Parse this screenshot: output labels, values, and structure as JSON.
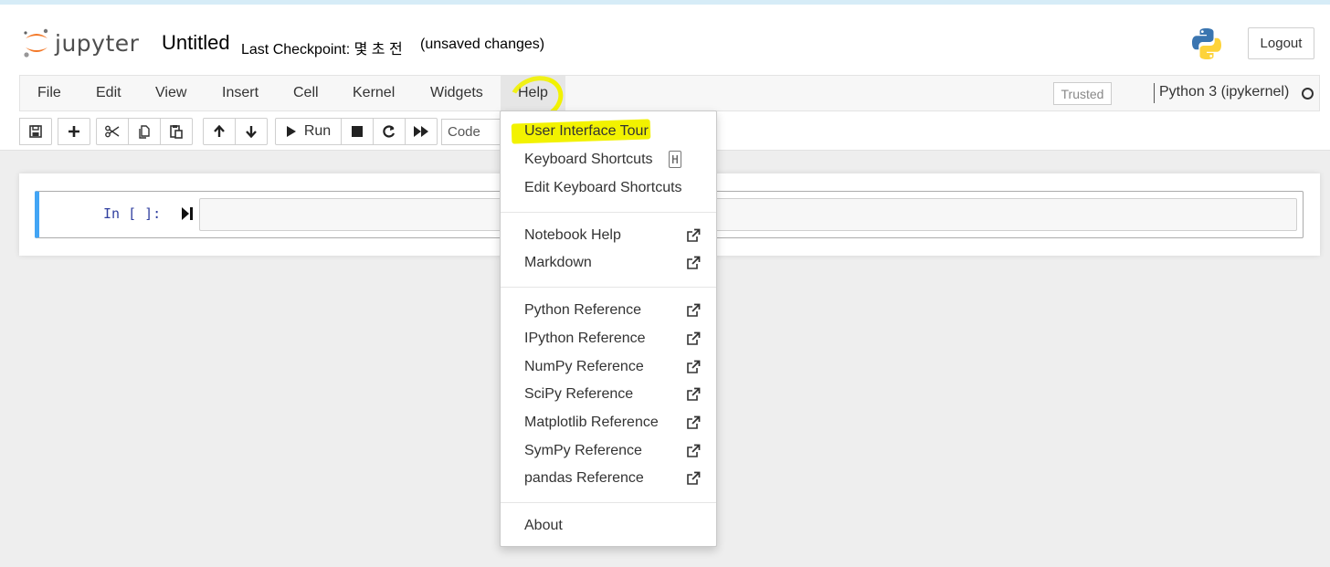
{
  "header": {
    "logo_text": "jupyter",
    "notebook_title": "Untitled",
    "checkpoint": "Last Checkpoint: 몇 초 전",
    "unsaved": "(unsaved changes)",
    "logout_label": "Logout"
  },
  "menubar": {
    "items": [
      "File",
      "Edit",
      "View",
      "Insert",
      "Cell",
      "Kernel",
      "Widgets",
      "Help"
    ],
    "trusted_label": "Trusted",
    "kernel_name": "Python 3 (ipykernel)"
  },
  "toolbar": {
    "run_label": "Run",
    "cell_type": "Code"
  },
  "cell": {
    "prompt": "In [ ]:"
  },
  "help_menu": {
    "items": [
      "User Interface Tour",
      "Keyboard Shortcuts",
      "Edit Keyboard Shortcuts",
      "Notebook Help",
      "Markdown",
      "Python Reference",
      "IPython Reference",
      "NumPy Reference",
      "SciPy Reference",
      "Matplotlib Reference",
      "SymPy Reference",
      "pandas Reference",
      "About"
    ],
    "shortcut_key": "H"
  },
  "colors": {
    "highlight": "#f2f200",
    "cell_accent": "#42a5f5",
    "prompt": "#303f9f",
    "logo_orange": "#f37726"
  },
  "icons": [
    "save-icon",
    "plus-icon",
    "cut-icon",
    "copy-icon",
    "paste-icon",
    "arrow-up-icon",
    "arrow-down-icon",
    "play-icon",
    "stop-icon",
    "restart-icon",
    "fast-forward-icon",
    "external-link-icon",
    "python-logo-icon",
    "kernel-idle-icon"
  ]
}
